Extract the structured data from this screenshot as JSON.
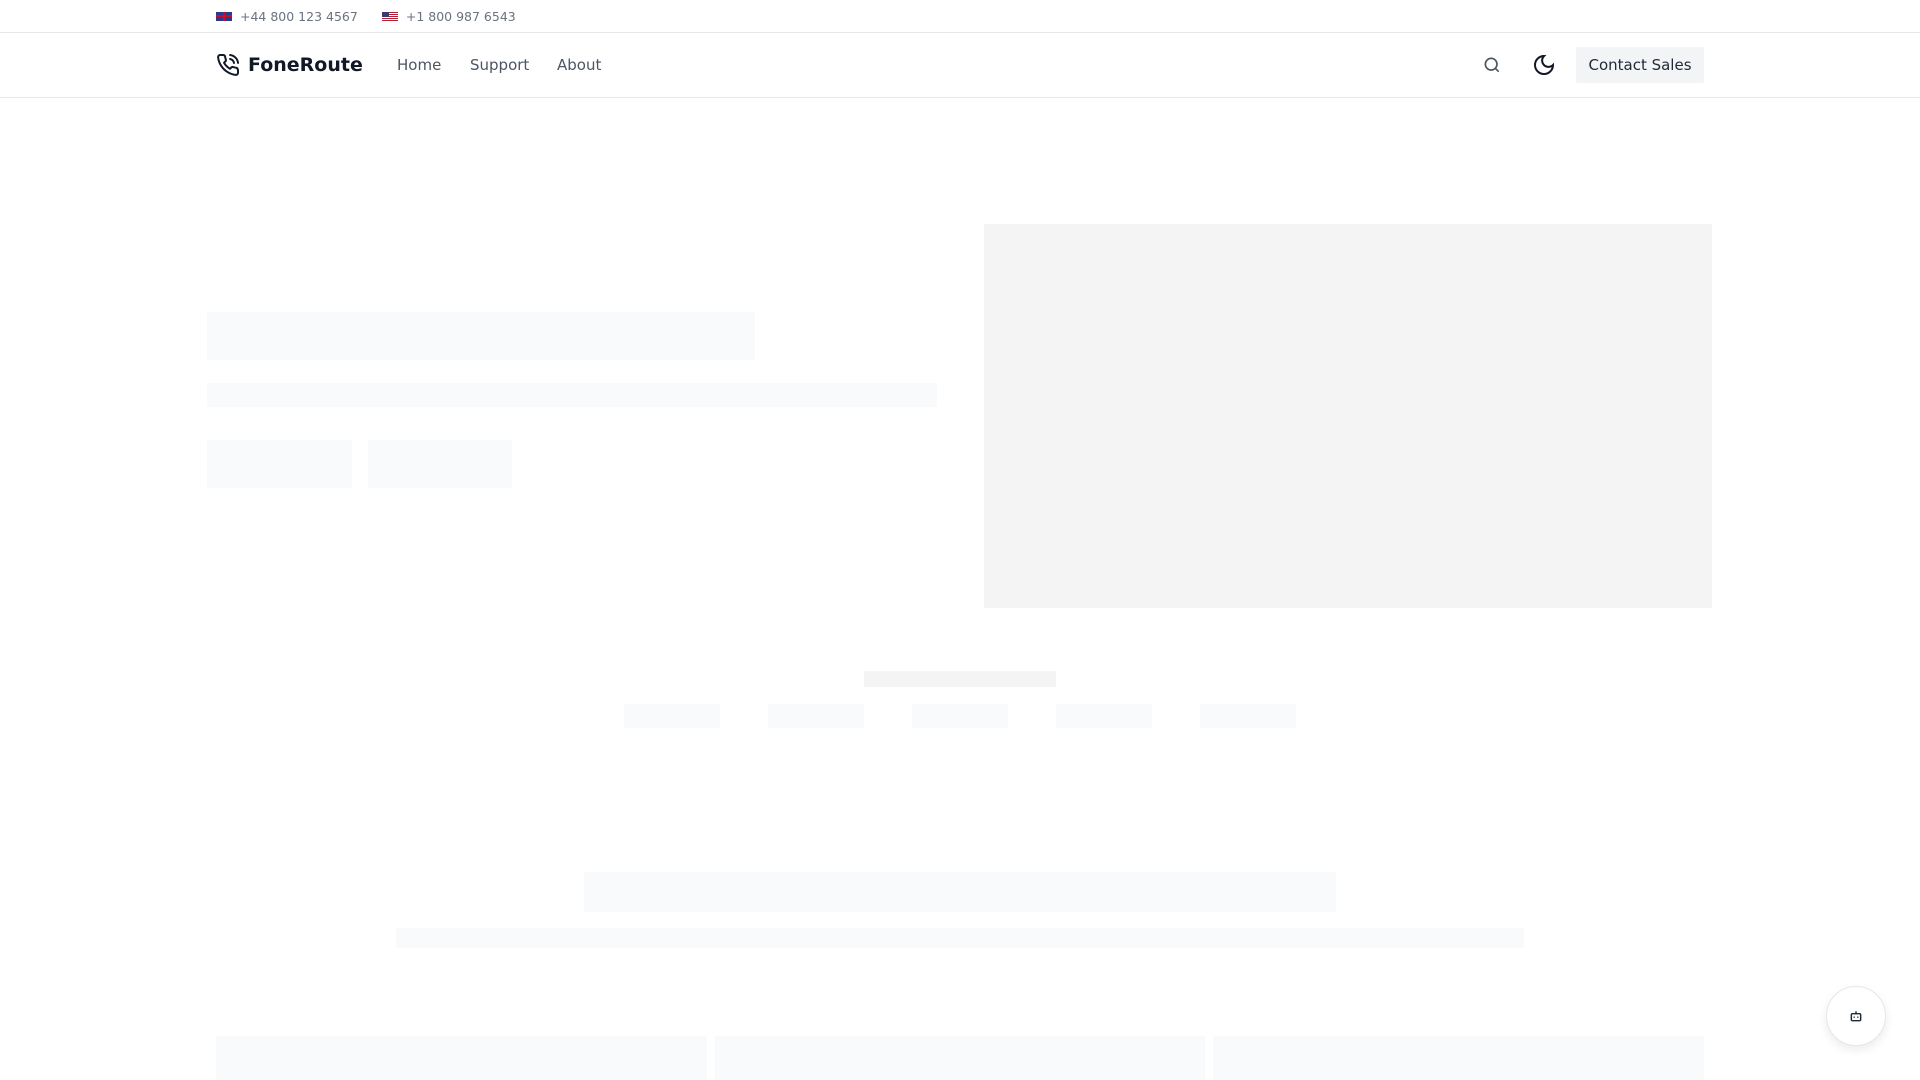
{
  "topbar": {
    "phones": [
      {
        "flag": "uk-flag-icon",
        "number": "+44 800 123 4567"
      },
      {
        "flag": "us-flag-icon",
        "number": "+1 800 987 6543"
      }
    ]
  },
  "nav": {
    "brand": "FoneRoute",
    "links": [
      "Home",
      "Support",
      "About"
    ],
    "cta": "Contact Sales"
  },
  "colors": {
    "skeleton": "#f9fafb",
    "skeleton_media": "#f4f4f5",
    "cta_bg": "#f3f4f6"
  }
}
